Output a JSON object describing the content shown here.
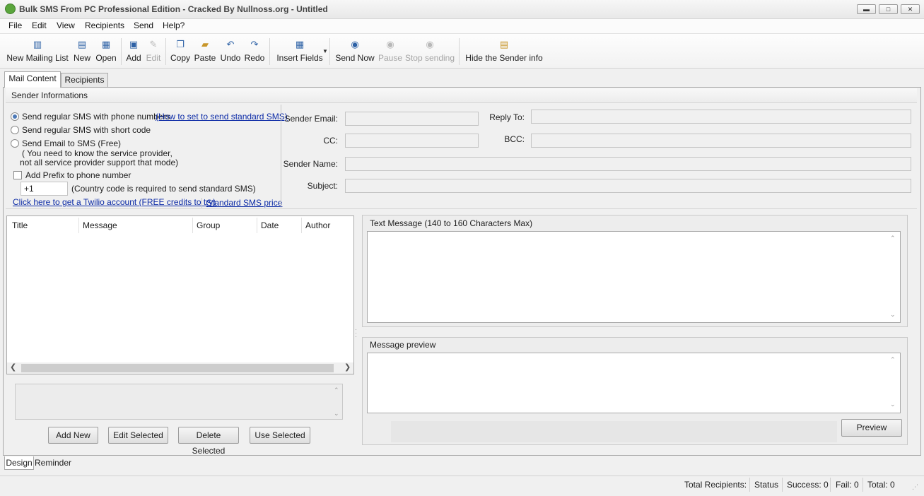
{
  "window": {
    "title": "Bulk SMS From PC Professional Edition - Cracked By Nullnoss.org - Untitled",
    "minimize_glyph": "▬",
    "maximize_glyph": "□",
    "close_glyph": "✕"
  },
  "menu": [
    "File",
    "Edit",
    "View",
    "Recipients",
    "Send",
    "Help?"
  ],
  "toolbar": {
    "new_mailing_list": "New Mailing List",
    "new": "New",
    "open": "Open",
    "add": "Add",
    "edit": "Edit",
    "copy": "Copy",
    "paste": "Paste",
    "undo": "Undo",
    "redo": "Redo",
    "insert_fields": "Insert Fields",
    "send_now": "Send Now",
    "pause": "Pause",
    "stop_sending": "Stop sending",
    "hide": "Hide",
    "sender_info": "the Sender info",
    "icons": {
      "new_mailing_list": "book-icon",
      "new": "new-document-icon",
      "open": "open-folder-icon",
      "add": "add-card-icon",
      "edit": "pencil-icon",
      "copy": "copy-icon",
      "paste": "paste-icon",
      "undo": "undo-icon",
      "redo": "redo-icon",
      "insert_fields": "table-icon",
      "send_now": "play-icon",
      "pause": "pause-icon",
      "stop_sending": "stop-icon",
      "hide": "sender-info-icon"
    }
  },
  "tabs": {
    "mail_content": "Mail Content",
    "recipients": "Recipients"
  },
  "sender": {
    "group_title": "Sender Informations",
    "opt_phone": "Send regular SMS with phone numbers",
    "opt_phone_link": "(How to set to send standard SMS)",
    "opt_short": "Send regular SMS with short code",
    "opt_email": "Send Email to SMS (Free)",
    "opt_email_note1": "( You need to know the service provider,",
    "opt_email_note2": "not all service provider support that mode)",
    "prefix_label": "Add Prefix to phone number",
    "prefix_value": "+1",
    "prefix_note": "(Country code is required to send standard SMS)",
    "twilio_link": "Click here to get a Twilio account (FREE credits to try)",
    "price_link": "Standard SMS price",
    "sender_email_label": "Sender Email:",
    "reply_to_label": "Reply To:",
    "cc_label": "CC:",
    "bcc_label": "BCC:",
    "sender_name_label": "Sender Name:",
    "subject_label": "Subject:"
  },
  "list": {
    "columns": [
      "Title",
      "Message",
      "Group",
      "Date",
      "Author"
    ],
    "rows": []
  },
  "buttons": {
    "add_new": "Add New",
    "edit_selected": "Edit Selected",
    "delete_selected": "Delete Selected",
    "use_selected": "Use Selected",
    "preview": "Preview"
  },
  "text_message": {
    "title": "Text Message (140 to 160 Characters Max)",
    "value": ""
  },
  "message_preview": {
    "title": "Message preview",
    "value": ""
  },
  "bottom_tabs": [
    "Design",
    "Reminder"
  ],
  "status": {
    "total_recipients": "Total Recipients:",
    "status": "Status",
    "success": "Success: 0",
    "fail": "Fail: 0",
    "total": "Total: 0"
  }
}
